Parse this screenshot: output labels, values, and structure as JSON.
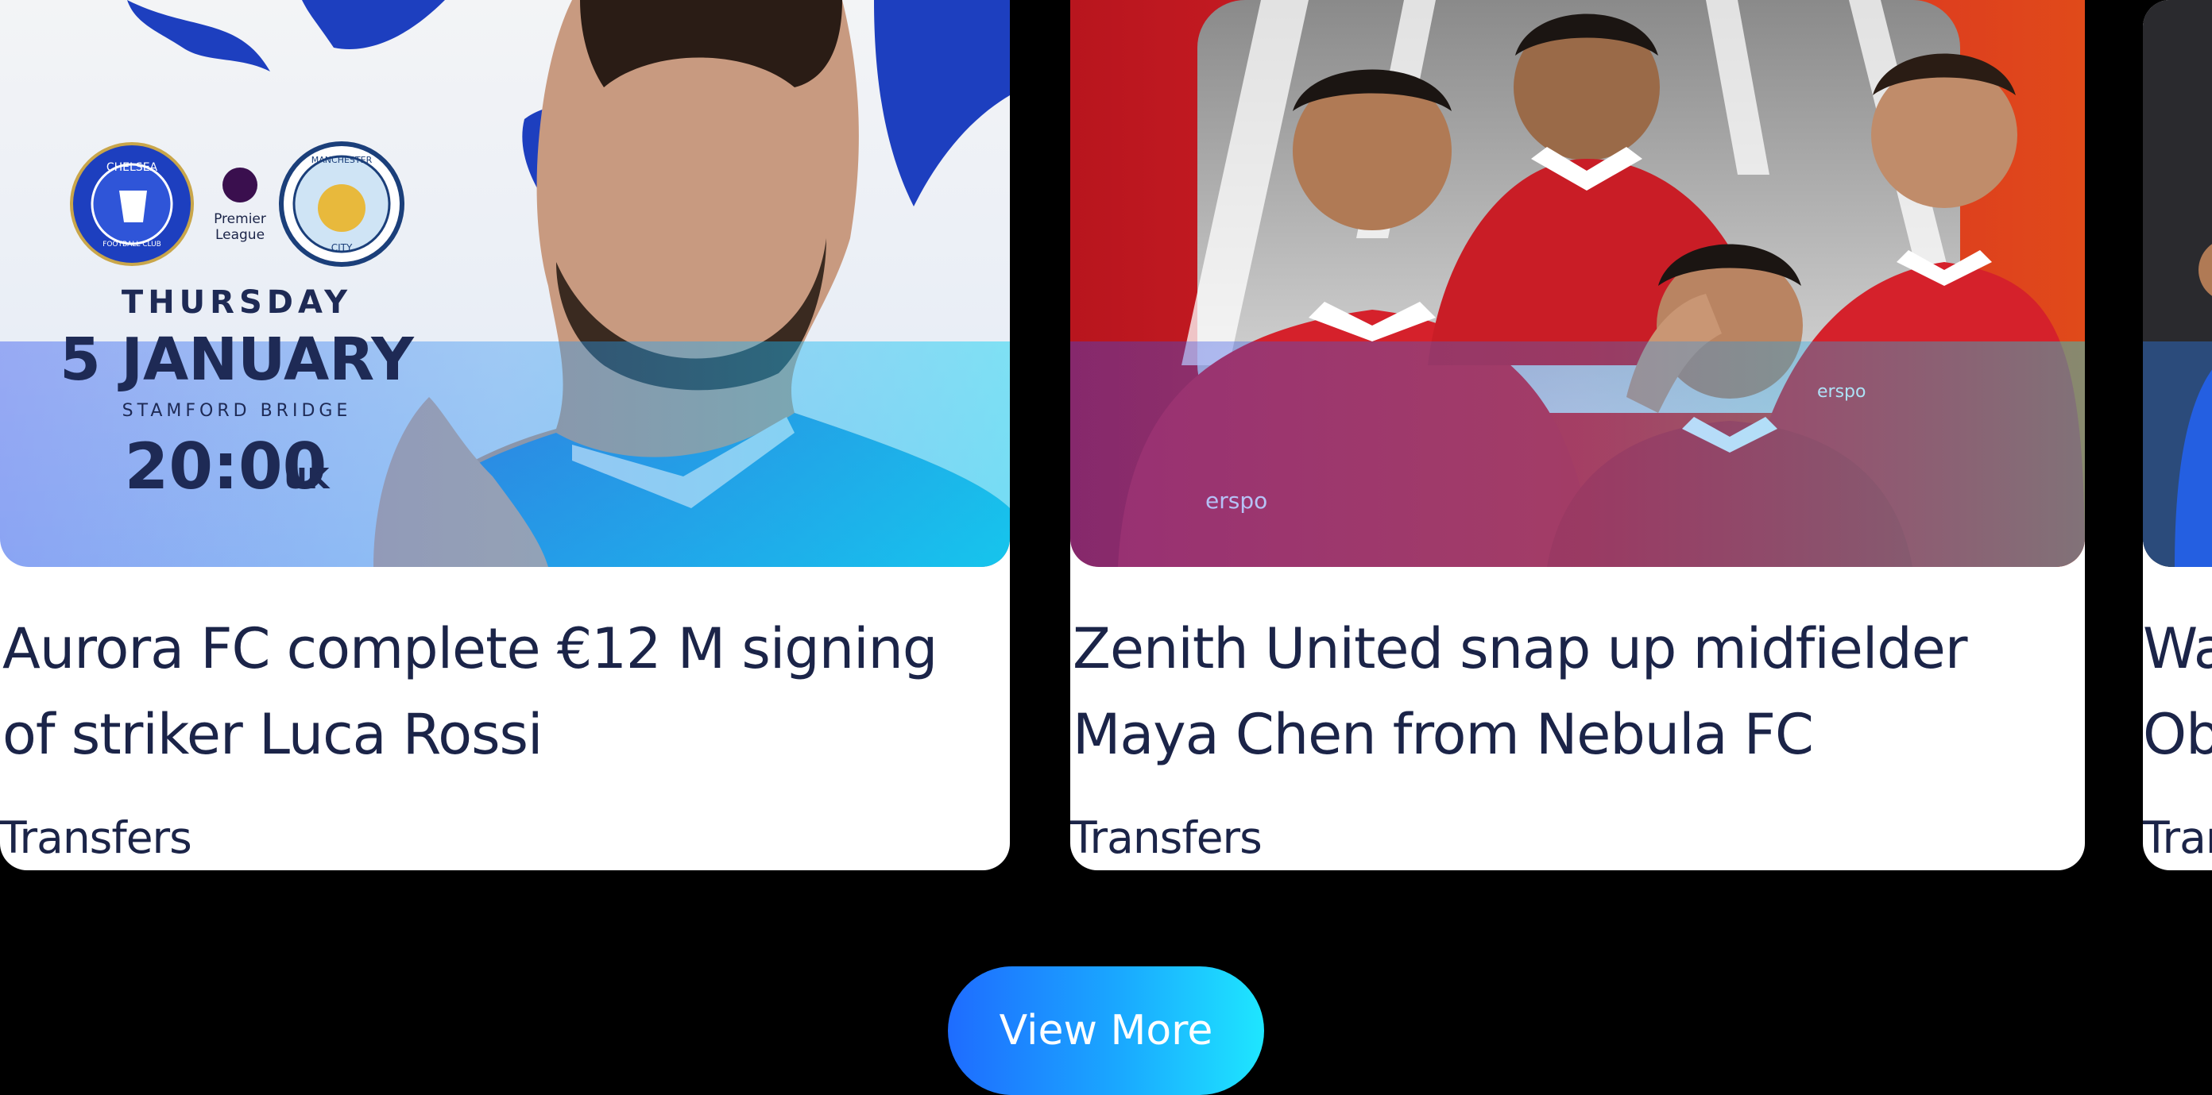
{
  "cards": [
    {
      "title_line1": "Aurora FC complete €12 M signing",
      "title_line2": "of striker Luca Rossi",
      "category": "Transfers",
      "poster": {
        "home_crest": "CHELSEA",
        "home_crest_sub": "FOOTBALL CLUB",
        "league_line1": "Premier",
        "league_line2": "League",
        "away_crest": "MANCHESTER",
        "away_crest_sub": "CITY",
        "day": "THURSDAY",
        "date": "5 JANUARY",
        "venue": "STAMFORD BRIDGE",
        "time": "20:00",
        "time_suffix": "UK"
      }
    },
    {
      "title_line1": "Zenith United snap up midfielder",
      "title_line2": "Maya Chen from Nebula FC",
      "category": "Transfers",
      "poster": {
        "sponsor": "erspo"
      }
    },
    {
      "title_line1": "Wa",
      "title_line2": "Ob",
      "category": "Trar"
    }
  ],
  "actions": {
    "view_more": "View More"
  },
  "colors": {
    "page_background": "#000000",
    "card_background": "#ffffff",
    "title_text": "#1b2448",
    "button_gradient_start": "#1e6cff",
    "button_gradient_end": "#1ee6ff"
  }
}
